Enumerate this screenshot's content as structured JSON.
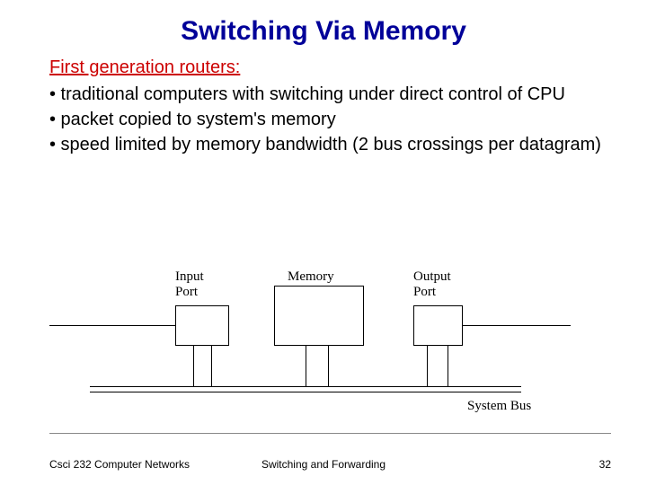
{
  "title": "Switching Via Memory",
  "subtitle": "First generation routers:",
  "bullets": [
    "• traditional computers with switching under direct control of CPU",
    "• packet copied to system's memory",
    "• speed limited by memory bandwidth (2 bus crossings per datagram)"
  ],
  "diagram": {
    "input_label": "Input\nPort",
    "memory_label": "Memory",
    "output_label": "Output\nPort",
    "bus_label": "System Bus"
  },
  "footer": {
    "left": "Csci 232 Computer Networks",
    "center": "Switching and Forwarding",
    "right": "32"
  }
}
